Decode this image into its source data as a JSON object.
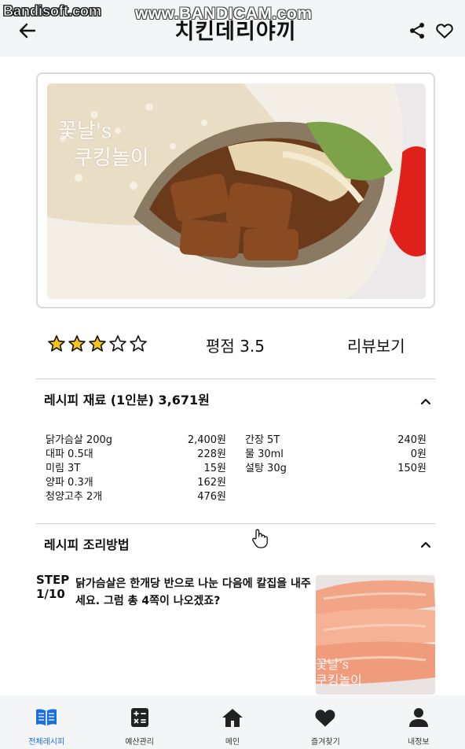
{
  "watermarks": {
    "left": "Bandisoft.com",
    "top": "www.BANDICAM.com",
    "photo_line1": "꽃날's",
    "photo_line2": "쿠킹놀이"
  },
  "header": {
    "title": "치킨데리야끼",
    "back_icon": "arrow-left-icon",
    "share_icon": "share-icon",
    "favorite_icon": "heart-outline-icon"
  },
  "rating": {
    "value": 3.5,
    "max": 5,
    "score_text": "평점 3.5",
    "reviews_label": "리뷰보기",
    "star_color": "#f5c518"
  },
  "ingredients": {
    "title": "레시피 재료 (1인분) 3,671원",
    "left": [
      {
        "name": "닭가슴살 200g",
        "price": "2,400원"
      },
      {
        "name": "대파 0.5대",
        "price": "228원"
      },
      {
        "name": "미림 3T",
        "price": "15원"
      },
      {
        "name": "양파 0.3개",
        "price": "162원"
      },
      {
        "name": "청양고추 2개",
        "price": "476원"
      }
    ],
    "right": [
      {
        "name": "간장 5T",
        "price": "240원"
      },
      {
        "name": "물 30ml",
        "price": "0원"
      },
      {
        "name": "설탕 30g",
        "price": "150원"
      }
    ]
  },
  "method": {
    "title": "레시피 조리방법",
    "steps": [
      {
        "label_line1": "STEP",
        "label_line2": "1/10",
        "text": "닭가슴살은 한개당 반으로 나눈 다음에 칼집을 내주세요. 그럼 총 4쪽이 나오겠죠?"
      }
    ]
  },
  "bottom_nav": {
    "active_color": "#1d6fd8",
    "items": [
      {
        "label": "전체레시피",
        "icon": "book-open-icon",
        "active": true
      },
      {
        "label": "예산관리",
        "icon": "calculator-icon",
        "active": false
      },
      {
        "label": "메인",
        "icon": "home-icon",
        "active": false
      },
      {
        "label": "즐겨찾기",
        "icon": "heart-icon",
        "active": false
      },
      {
        "label": "내정보",
        "icon": "person-icon",
        "active": false
      }
    ]
  }
}
